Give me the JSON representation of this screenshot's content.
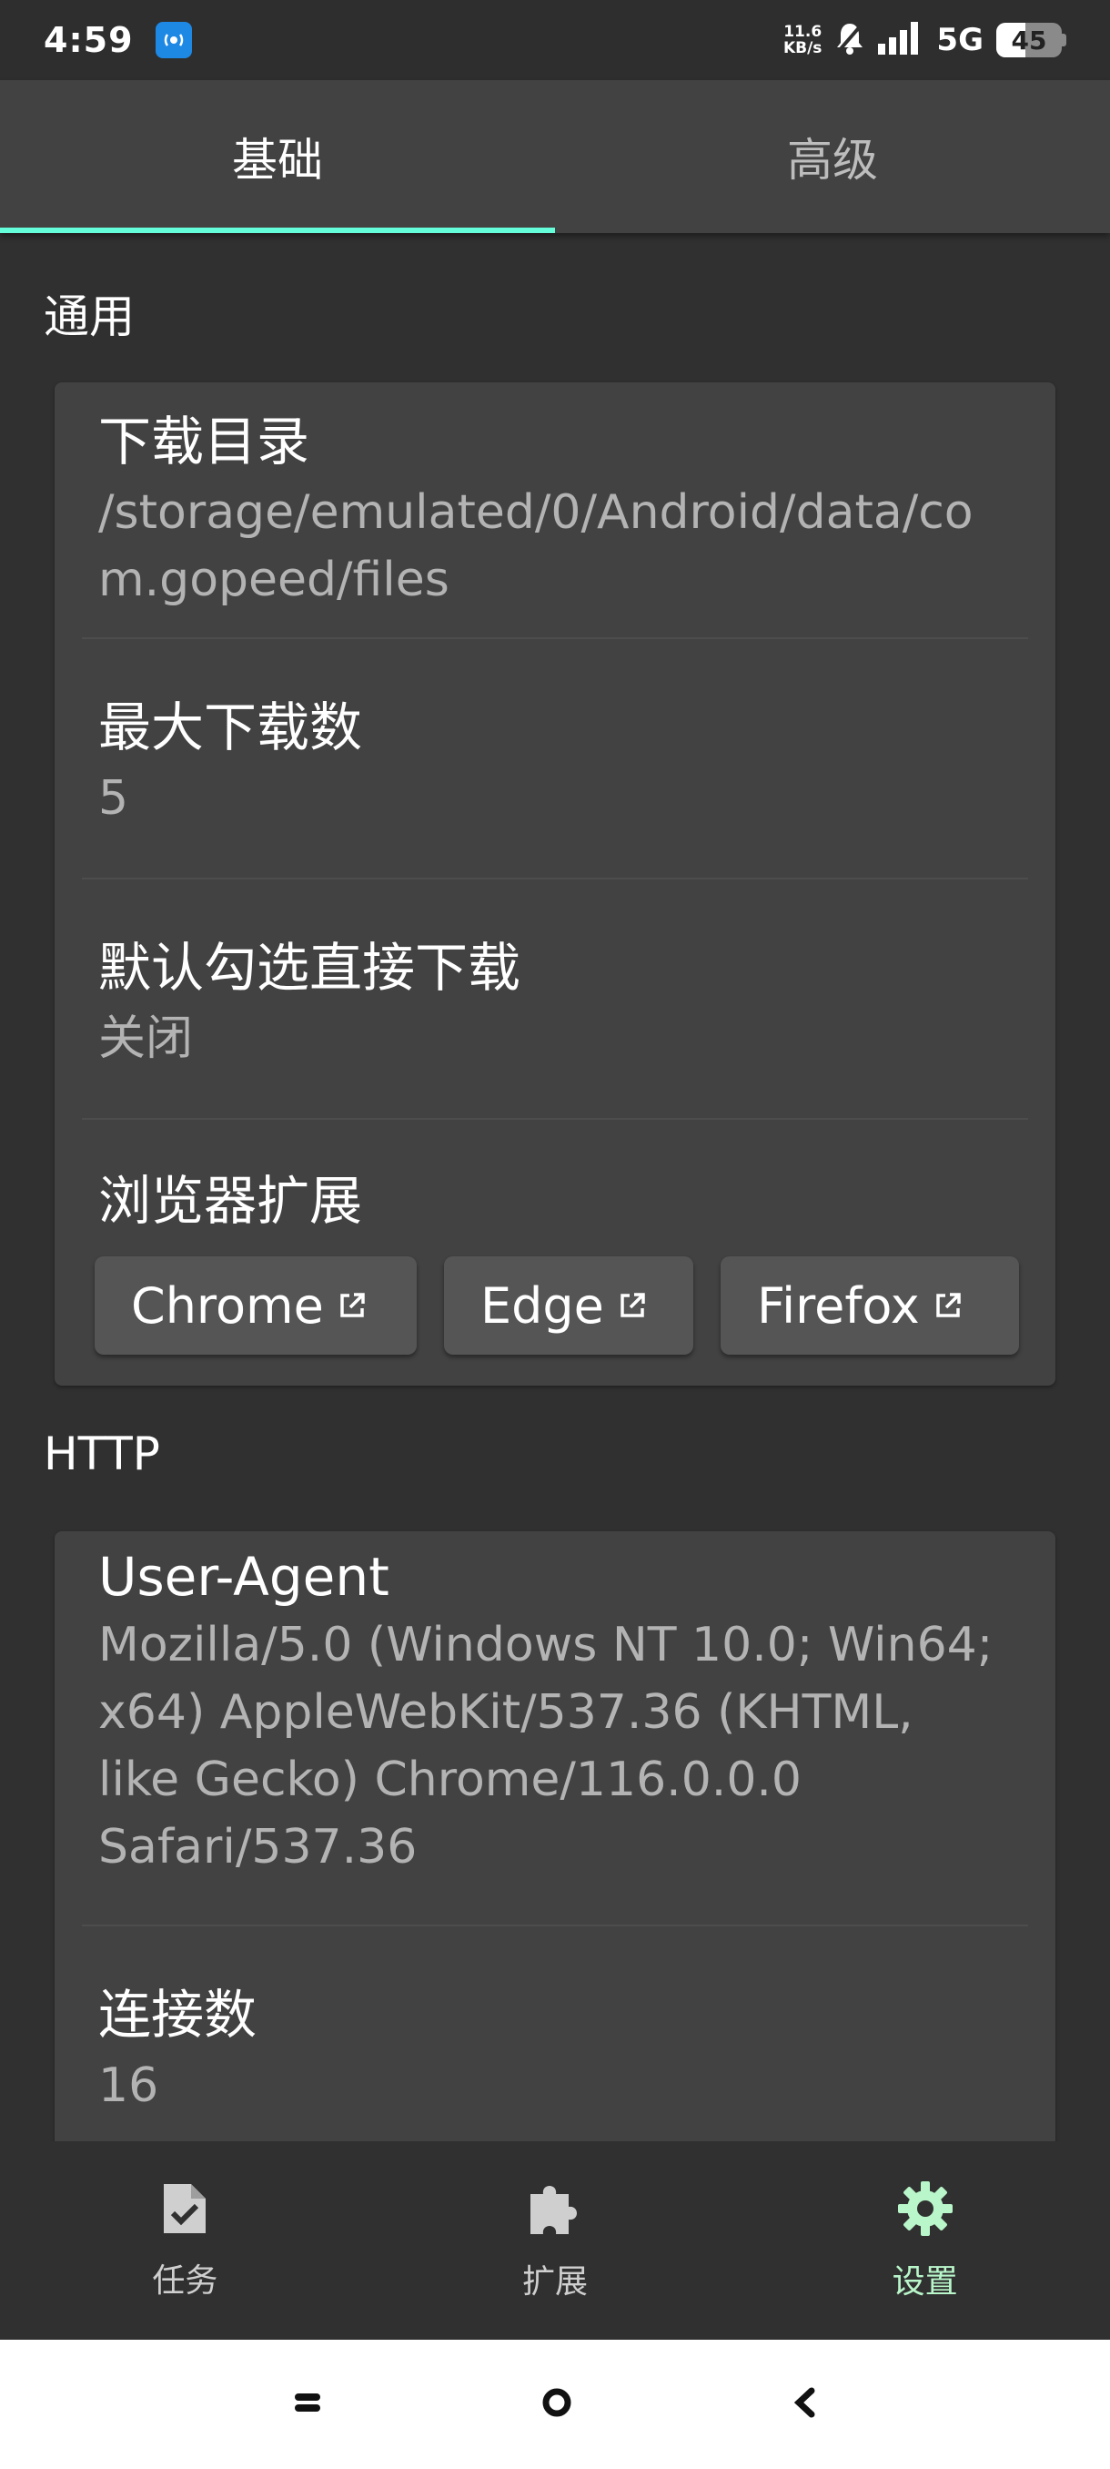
{
  "status_bar": {
    "time": "4:59",
    "speed_value": "11.6",
    "speed_unit": "KB/s",
    "network": "5G",
    "battery": "45",
    "battery_level": 0.45
  },
  "tabs": [
    {
      "label": "基础",
      "active": true
    },
    {
      "label": "高级",
      "active": false
    }
  ],
  "sections": {
    "general": {
      "title": "通用",
      "download_dir": {
        "title": "下载目录",
        "value": "/storage/emulated/0/Android/data/com.gopeed/files"
      },
      "max_downloads": {
        "title": "最大下载数",
        "value": "5"
      },
      "direct_download": {
        "title": "默认勾选直接下载",
        "value": "关闭"
      },
      "browser_ext": {
        "title": "浏览器扩展",
        "buttons": [
          {
            "label": "Chrome"
          },
          {
            "label": "Edge"
          },
          {
            "label": "Firefox"
          }
        ]
      }
    },
    "http": {
      "title": "HTTP",
      "user_agent": {
        "title": "User-Agent",
        "value": "Mozilla/5.0 (Windows NT 10.0; Win64; x64) AppleWebKit/537.36 (KHTML, like Gecko) Chrome/116.0.0.0 Safari/537.36"
      },
      "connections": {
        "title": "连接数",
        "value": "16"
      }
    }
  },
  "bottom_nav": [
    {
      "label": "任务",
      "icon": "task-icon",
      "active": false
    },
    {
      "label": "扩展",
      "icon": "puzzle-icon",
      "active": false
    },
    {
      "label": "设置",
      "icon": "gear-icon",
      "active": true
    }
  ],
  "colors": {
    "accent": "#64ffda",
    "nav_active": "#b9f6ca",
    "background": "#303030",
    "card": "#424242"
  }
}
